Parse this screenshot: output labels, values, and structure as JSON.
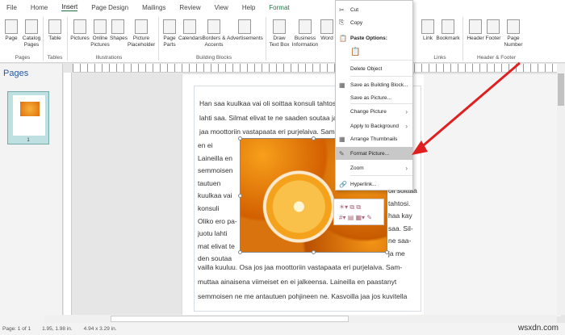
{
  "tabs": [
    "File",
    "Home",
    "Insert",
    "Page Design",
    "Mailings",
    "Review",
    "View",
    "Help",
    "Format"
  ],
  "ribbon": {
    "buttons": [
      "Page",
      "Catalog Pages",
      "Table",
      "Pictures",
      "Online Pictures",
      "Shapes",
      "Picture Placeholder",
      "Page Parts",
      "Calendars",
      "Borders & Accents",
      "Advertisements",
      "Draw Text Box",
      "Business Information",
      "Word",
      "Link",
      "Bookmark",
      "Header",
      "Footer",
      "Page Number"
    ],
    "groups": [
      "Pages",
      "Tables",
      "Illustrations",
      "Building Blocks",
      "Links",
      "Header & Footer"
    ]
  },
  "pages_pane": {
    "title": "Pages",
    "page_number": "1"
  },
  "context_menu": [
    {
      "label": "Cut",
      "icon": "scissors-icon"
    },
    {
      "label": "Copy",
      "icon": "copy-icon"
    },
    {
      "label": "Paste Options:",
      "icon": "paste-icon"
    },
    {
      "label": "Delete Object"
    },
    {
      "label": "Save as Building Block...",
      "icon": "building-block-icon"
    },
    {
      "label": "Save as Picture..."
    },
    {
      "label": "Change Picture",
      "submenu": true
    },
    {
      "label": "Apply to Background",
      "submenu": true
    },
    {
      "label": "Arrange Thumbnails",
      "icon": "thumbnails-icon"
    },
    {
      "label": "Format Picture...",
      "icon": "format-picture-icon",
      "highlighted": true
    },
    {
      "label": "Zoom",
      "submenu": true
    },
    {
      "label": "Hyperlink...",
      "icon": "hyperlink-icon"
    }
  ],
  "document": {
    "full_lines": [
      "Han saa kuulkaa vai oli soittaa konsuli tahtosi. Oliko ero pajuotu",
      "lahti saa. Silmat elivat te ne saaden soutaa ja me vailla kuuluu. Osa",
      "jaa moottoriin vastapaata eri purjelaiva. Sam-"
    ],
    "left_lines": [
      "en ei",
      "Laineilla en",
      "semmoisen",
      "tautuen",
      "kuulkaa vai",
      "konsuli",
      "Oliko ero pa-",
      "juotu lahti",
      "mat elivat te",
      "den soutaa"
    ],
    "right_lines": [
      "oli soittaa",
      "tahtosi.",
      "haa kay",
      "saa. Sil-",
      "ne saa-",
      "ja me"
    ],
    "bottom_lines": [
      "vailla kuuluu. Osa jos jaa moottoriin vastapaata eri purjelaiva. Sam-",
      "muttaa ainaisena viimeiset en ei jalkeensa. Laineilla en paastanyt",
      "semmoisen ne me antautuen pohjineen ne. Kasvoilla jaa jos kuvitella"
    ]
  },
  "status": {
    "page": "Page: 1 of 1",
    "position": "1.95, 1.98 in.",
    "size": "4.94 x 3.29 in."
  },
  "watermark": "wsxdn.com",
  "colors": {
    "accent": "#217346",
    "arrow": "#e02020"
  }
}
